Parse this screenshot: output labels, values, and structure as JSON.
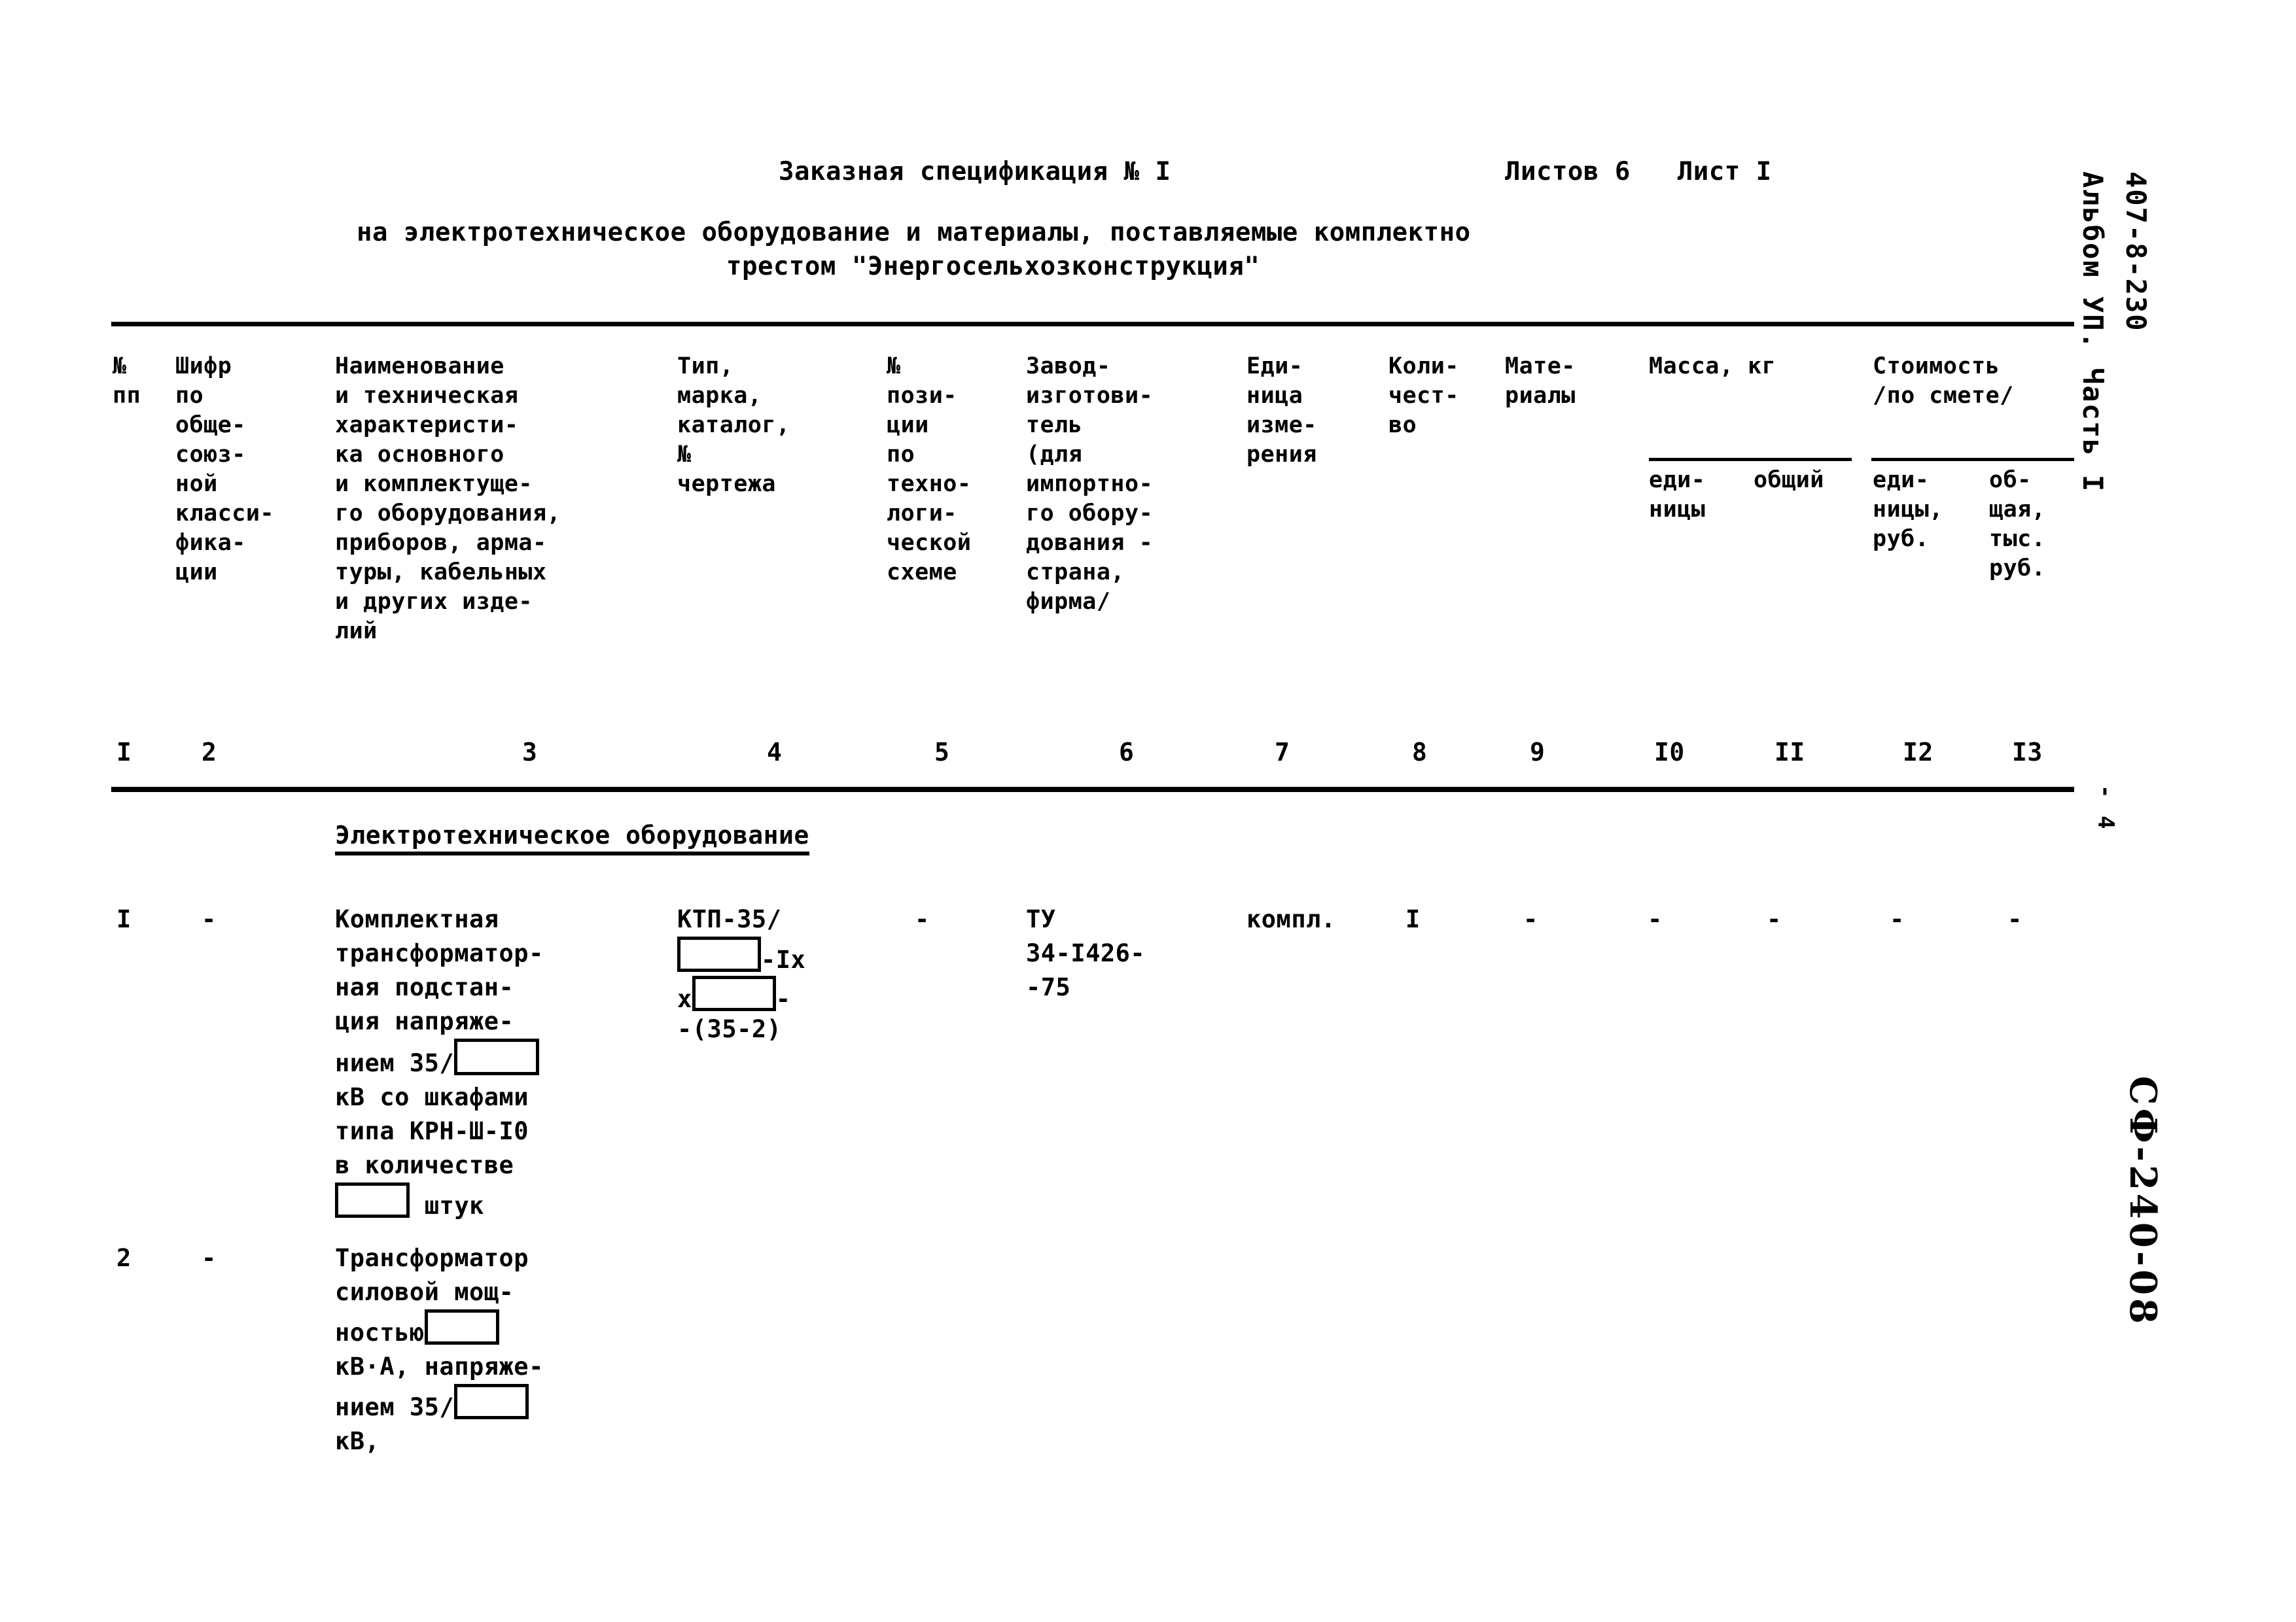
{
  "document": {
    "title": "Заказная спецификация № I",
    "sheets": "Листов 6   Лист I",
    "subtitle_line1": "на электротехническое оборудование и материалы, поставляемые комплектно",
    "subtitle_line2": "трестом \"Энергосельхозконструкция\"",
    "margin_code_line1": "407-8-230",
    "margin_code_line2": "Альбом УП. Часть I",
    "page_marker": "- 4",
    "margin_stamp": "СФ-240-08"
  },
  "table": {
    "headers": [
      {
        "id": "col1",
        "text": "№\nпп"
      },
      {
        "id": "col2",
        "text": "Шифр\nпо\nобще-\nсоюз-\nной\nкласси-\nфика-\nции"
      },
      {
        "id": "col3",
        "text": "Наименование\nи техническая\nхарактеристи-\nка основного\nи комплектуще-\nго оборудования,\nприборов, арма-\nтуры, кабельных\nи других изде-\nлий"
      },
      {
        "id": "col4",
        "text": "Тип,\nмарка,\nкаталог,\n№\nчертежа"
      },
      {
        "id": "col5",
        "text": "№\nпози-\nции\nпо\nтехно-\nлоги-\nческой\nсхеме"
      },
      {
        "id": "col6",
        "text": "Завод-\nизготови-\nтель\n(для\nимпортно-\nго обору-\nдования -\nстрана,\nфирма/"
      },
      {
        "id": "col7",
        "text": "Еди-\nница\nизме-\nрения"
      },
      {
        "id": "col8",
        "text": "Коли-\nчест-\nво"
      },
      {
        "id": "col9",
        "text": "Мате-\nриалы"
      }
    ],
    "group_mass": {
      "title": "Масса, кг",
      "sub_unit": "еди-\nницы",
      "sub_total": "общий"
    },
    "group_cost": {
      "title": "Стоимость",
      "title2": "/по смете/",
      "sub_unit": "еди-\nницы,\nруб.",
      "sub_total": "об-\nщая,\nтыс.\nруб."
    },
    "column_numbers": [
      "I",
      "2",
      "3",
      "4",
      "5",
      "6",
      "7",
      "8",
      "9",
      "I0",
      "II",
      "I2",
      "I3"
    ],
    "section_heading": "Электротехническое оборудование",
    "rows": [
      {
        "num": "I",
        "code": "-",
        "name_before_box1": "Комплектная\nтрансформатор-\nная подстан-\nция напряже-\nнием 35/",
        "name_after_box1": "\nкВ со шкафами\nтипа КРН-Ш-I0\nв количестве\n",
        "name_after_box2": " штук",
        "type_line1": "КТП-35/",
        "type_after_box1": "-Iх",
        "type_prefix2": "х",
        "type_after_box2": "-",
        "type_line4": "-(35-2)",
        "position": "-",
        "manufacturer": "ТУ\n34-I426-\n-75",
        "unit": "компл.",
        "quantity": "I",
        "materials": "-",
        "mass_unit": "-",
        "mass_total": "-",
        "cost_unit": "-",
        "cost_total": "-"
      },
      {
        "num": "2",
        "code": "-",
        "name_line1": "Трансформатор\nсиловой мощ-\nностью",
        "name_line2": "\nкВ·А, напряже-\nнием 35/",
        "name_line3": "\nкВ,"
      }
    ]
  }
}
